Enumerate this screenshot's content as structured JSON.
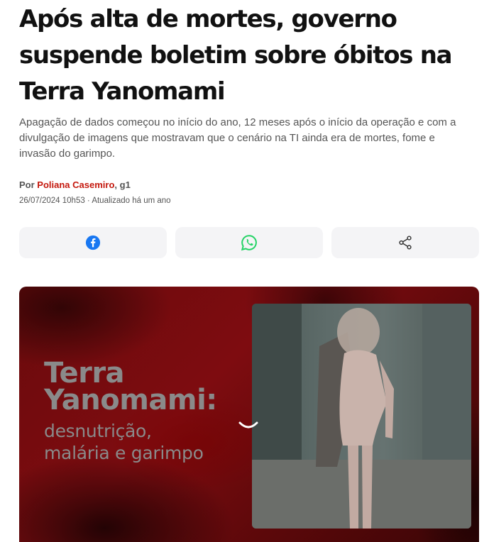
{
  "article": {
    "headline": "Após alta de mortes, governo suspende boletim sobre óbitos na Terra Yanomami",
    "summary": "Apagação de dados começou no início do ano, 12 meses após o início da operação e com a divulgação de imagens que mostravam que o cenário na TI ainda era de mortes, fome e invasão do garimpo.",
    "byline": {
      "prefix": "Por ",
      "author": "Poliana Casemiro",
      "suffix": ", g1"
    },
    "dateline": "26/07/2024 10h53 · Atualizado há um ano"
  },
  "share": {
    "buttons": [
      {
        "name": "facebook",
        "icon": "facebook-icon",
        "color": "#1877f2"
      },
      {
        "name": "whatsapp",
        "icon": "whatsapp-icon",
        "color": "#25d366"
      },
      {
        "name": "share",
        "icon": "share-icon",
        "color": "#333333"
      }
    ]
  },
  "media": {
    "title_line1": "Terra",
    "title_line2": "Yanomami:",
    "subtitle_line1": "desnutrição,",
    "subtitle_line2": "malária e garimpo",
    "background_color": "#7a0b0f",
    "text_color": "#8a8a8a"
  }
}
